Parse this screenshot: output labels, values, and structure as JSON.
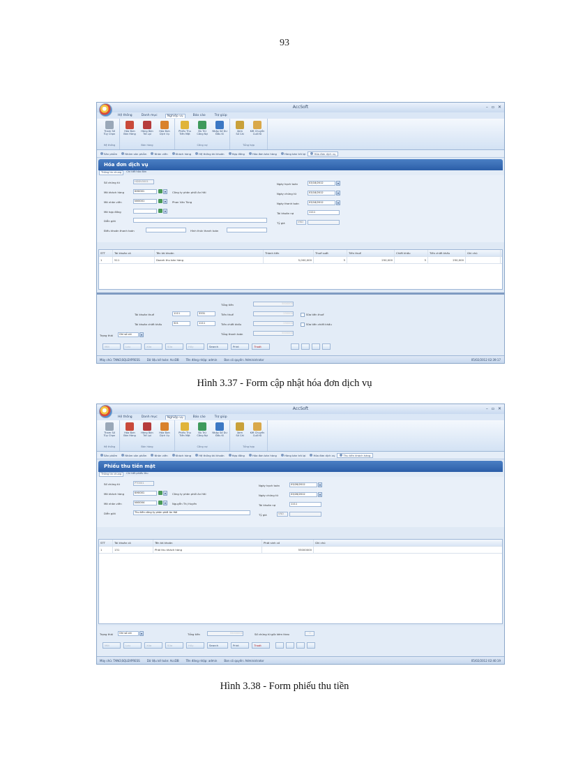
{
  "page_number": "93",
  "figures": [
    {
      "caption": "Hình 3.37 - Form cập nhật hóa đơn dịch vụ",
      "app_title": "AccSoft",
      "menu": [
        "Hệ thống",
        "Danh mục",
        "Nghiệp vụ",
        "Báo cáo",
        "Trợ giúp"
      ],
      "ribbon_groups": [
        {
          "label": "Hệ thống",
          "buttons": [
            "Tham Số\nTùy Chọn"
          ]
        },
        {
          "label": "Bán hàng",
          "buttons": [
            "Hóa Đơn\nBán Hàng",
            "Hàng Bán\nTrả Lại",
            "Hóa Đơn\nDịch Vụ"
          ]
        },
        {
          "label": "Công nợ",
          "buttons": [
            "Phiếu Thu\nTiền Mặt",
            "Bù Trừ\nCông Nợ",
            "Nhập Số Dư\nĐầu Kì"
          ]
        },
        {
          "label": "Tổng hợp",
          "buttons": [
            "Xem\nSổ Cái",
            "Kết Chuyển\nCuối Kì"
          ]
        }
      ],
      "tabs": [
        "Sản phẩm",
        "Nhóm sản phẩm",
        "Nhân viên",
        "Khách hàng",
        "Hệ thống tài khoản",
        "Hợp đồng",
        "Hóa đơn bán hàng",
        "Hàng bán trả lại",
        "Hóa đơn dịch vụ"
      ],
      "form_title": "Hóa đơn dịch vụ",
      "subtabs": [
        "Thông tin chung",
        "Chi tiết hóa đơn"
      ],
      "fields": {
        "so_chung_tu_label": "Số chứng từ",
        "so_chung_tu": "HDDV0001",
        "ma_kh_label": "Mã khách hàng",
        "ma_kh": "KH0001",
        "ten_kh": "Công ty phân phối An Hải",
        "ma_nv_label": "Mã nhân viên",
        "ma_nv": "NV0001",
        "ten_nv": "Phan Văn Tùng",
        "ma_hd_label": "Mã hợp đồng",
        "ma_hd": "",
        "dien_giai_label": "Diễn giải",
        "dien_giai": "",
        "dieu_khoan_label": "Điều khoản thanh toán",
        "dieu_khoan": "",
        "hinh_thuc_label": "Hình thức thanh toán",
        "hinh_thuc": "",
        "ngay_hach_toan_label": "Ngày hạch toán",
        "ngay_hach_toan": "03/18/2012",
        "ngay_chung_tu_label": "Ngày chứng từ",
        "ngay_chung_tu": "03/18/2012",
        "ngay_thanh_toan_label": "Ngày thanh toán",
        "ngay_thanh_toan": "03/18/2012",
        "tk_no_label": "Tài khoản nợ",
        "tk_no": "1111",
        "ty_gia_label": "Tỷ giá",
        "ty_gia_code": "VND",
        "ty_gia": ""
      },
      "grid_headers": [
        "STT",
        "Tài khoản có",
        "Tên tài khoản",
        "Thành tiền",
        "Thuế suất",
        "Tiền thuế",
        "Chiết khấu",
        "Tiền chiết khấu",
        "Ghi chú"
      ],
      "grid_rows": [
        [
          "1",
          "511",
          "Doanh thu bán hàng",
          "5,000,000",
          "5",
          "250,000",
          "5",
          "250,000",
          ""
        ]
      ],
      "summary": {
        "tk_thue_label": "Tài khoản thuế",
        "tk_thue_1": "1111",
        "tk_thue_2": "3331",
        "tk_ck_label": "Tài khoản chiết khấu",
        "tk_ck_1": "521",
        "tk_ck_2": "1111",
        "tong_tien_label": "Tổng tiền",
        "tong_tien": "5000000",
        "tien_thue_label": "Tiền thuế",
        "tien_thue": "250000",
        "tien_ck_label": "Tiền chiết khấu",
        "tien_ck": "250000",
        "tong_tt_label": "Tổng thanh toán",
        "tong_tt": "5000000",
        "sua_thue": "Sửa tiền thuế",
        "sua_ck": "Sửa tiền chiết khấu",
        "trang_thai_label": "Trạng thái",
        "trang_thai": "Ghi sổ cái"
      },
      "actions": [
        "Mới",
        "Lưu",
        "Xóa",
        "Sửa",
        "Hủy",
        "Search",
        "Print",
        "Thoát"
      ],
      "status": {
        "server": "Máy chủ: TANG\\SQLEXPRESS",
        "db": "Dữ liệu kế toán: AccDB",
        "user": "Tên đăng nhập: admin",
        "role": "Ban có quyền: Administrator",
        "clock": "05/02/2012 02:39:17"
      }
    },
    {
      "caption": "Hình 3.38 - Form phiếu thu tiền",
      "app_title": "AccSoft",
      "menu": [
        "Hệ thống",
        "Danh mục",
        "Nghiệp vụ",
        "Báo cáo",
        "Trợ giúp"
      ],
      "ribbon_groups": [
        {
          "label": "Hệ thống",
          "buttons": [
            "Tham Số\nTùy Chọn"
          ]
        },
        {
          "label": "Bán hàng",
          "buttons": [
            "Hóa Đơn\nBán Hàng",
            "Hàng Bán\nTrả Lại",
            "Hóa Đơn\nDịch Vụ"
          ]
        },
        {
          "label": "Công nợ",
          "buttons": [
            "Phiếu Thu\nTiền Mặt",
            "Bù Trừ\nCông Nợ",
            "Nhập Số Dư\nĐầu Kì"
          ]
        },
        {
          "label": "Tổng hợp",
          "buttons": [
            "Xem\nSổ Cái",
            "Kết Chuyển\nCuối Kì"
          ]
        }
      ],
      "tabs": [
        "Sản phẩm",
        "Nhóm sản phẩm",
        "Nhân viên",
        "Khách hàng",
        "Hệ thống tài khoản",
        "Hợp đồng",
        "Hóa đơn bán hàng",
        "Hàng bán trả lại",
        "Hóa đơn dịch vụ",
        "Thu tiền khách hàng"
      ],
      "form_title": "Phiếu thu tiền mặt",
      "subtabs": [
        "Thông tin chung",
        "Chi tiết phiếu thu"
      ],
      "fields": {
        "so_chung_tu_label": "Số chứng từ",
        "so_chung_tu": "PT0001",
        "ma_kh_label": "Mã khách hàng",
        "ma_kh": "KH0001",
        "ten_kh": "Công ty phân phối An Hải",
        "ma_nv_label": "Mã nhân viên",
        "ma_nv": "NV0004",
        "ten_nv": "Nguyễn Thị Huyền",
        "dien_giai_label": "Diễn giải",
        "dien_giai": "Thu tiền công ty phân phối An Hải",
        "ngay_hach_toan_label": "Ngày hạch toán",
        "ngay_hach_toan": "03/28/2012",
        "ngay_chung_tu_label": "Ngày chứng từ",
        "ngay_chung_tu": "03/28/2012",
        "tk_no_label": "Tài khoản nợ",
        "tk_no": "1111",
        "ty_gia_label": "Tỷ giá",
        "ty_gia_code": "VND",
        "ty_gia": ""
      },
      "grid_headers": [
        "STT",
        "Tài khoản có",
        "Tên tài khoản",
        "Phát sinh có",
        "Ghi chú"
      ],
      "grid_rows": [
        [
          "1",
          "131",
          "Phải thu khách hàng",
          "55000000",
          ""
        ]
      ],
      "summary": {
        "trang_thai_label": "Trạng thái",
        "trang_thai": "Ghi sổ cái",
        "tong_tien_label": "Tổng tiền",
        "tong_tien": "55000000",
        "so_ct_label": "Số chứng từ gốc kèm theo",
        "so_ct": "0"
      },
      "actions": [
        "Mới",
        "Lưu",
        "Xóa",
        "Sửa",
        "Hủy",
        "Search",
        "Print",
        "Thoát"
      ],
      "status": {
        "server": "Máy chủ: TANG\\SQLEXPRESS",
        "db": "Dữ liệu kế toán: AccDB",
        "user": "Tên đăng nhập: admin",
        "role": "Ban có quyền: Administrator",
        "clock": "05/02/2012 02:40:19"
      }
    }
  ]
}
